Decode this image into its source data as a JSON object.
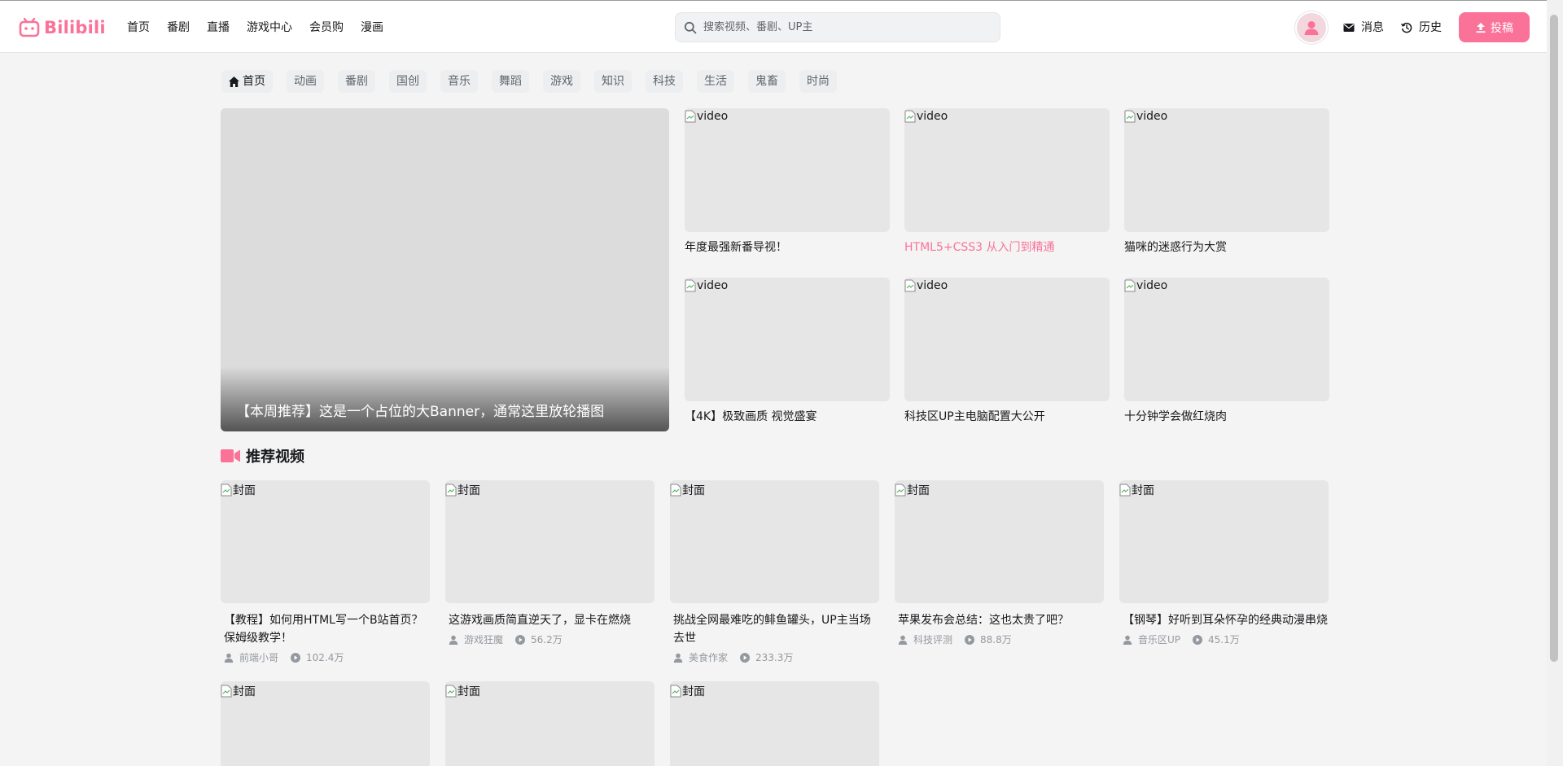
{
  "header": {
    "logo_text": "Bilibili",
    "nav": [
      "首页",
      "番剧",
      "直播",
      "游戏中心",
      "会员购",
      "漫画"
    ],
    "search_placeholder": "搜索视频、番剧、UP主",
    "messages": "消息",
    "history": "历史",
    "upload": "投稿"
  },
  "channels": [
    "首页",
    "动画",
    "番剧",
    "国创",
    "音乐",
    "舞蹈",
    "游戏",
    "知识",
    "科技",
    "生活",
    "鬼畜",
    "时尚"
  ],
  "banner": {
    "title": "【本周推荐】这是一个占位的大Banner，通常这里放轮播图"
  },
  "top_videos": [
    {
      "alt": "video",
      "title": "年度最强新番导视！"
    },
    {
      "alt": "video",
      "title": "HTML5+CSS3 从入门到精通"
    },
    {
      "alt": "video",
      "title": "猫咪的迷惑行为大赏"
    },
    {
      "alt": "video",
      "title": "【4K】极致画质 视觉盛宴"
    },
    {
      "alt": "video",
      "title": "科技区UP主电脑配置大公开"
    },
    {
      "alt": "video",
      "title": "十分钟学会做红烧肉"
    }
  ],
  "section": {
    "title": "推荐视频"
  },
  "recommended": [
    {
      "alt": "封面",
      "title": "【教程】如何用HTML写一个B站首页？保姆级教学！",
      "up": "前端小哥",
      "views": "102.4万"
    },
    {
      "alt": "封面",
      "title": "这游戏画质简直逆天了，显卡在燃烧",
      "up": "游戏狂魔",
      "views": "56.2万"
    },
    {
      "alt": "封面",
      "title": "挑战全网最难吃的鲱鱼罐头，UP主当场去世",
      "up": "美食作家",
      "views": "233.3万"
    },
    {
      "alt": "封面",
      "title": "苹果发布会总结：这也太贵了吧？",
      "up": "科技评测",
      "views": "88.8万"
    },
    {
      "alt": "封面",
      "title": "【钢琴】好听到耳朵怀孕的经典动漫串烧",
      "up": "音乐区UP",
      "views": "45.1万"
    },
    {
      "alt": "封面"
    },
    {
      "alt": "封面"
    },
    {
      "alt": "封面"
    }
  ],
  "colors": {
    "brand": "#fb7299",
    "text": "#18191c",
    "muted": "#9499a0",
    "bg": "#f4f4f4"
  }
}
